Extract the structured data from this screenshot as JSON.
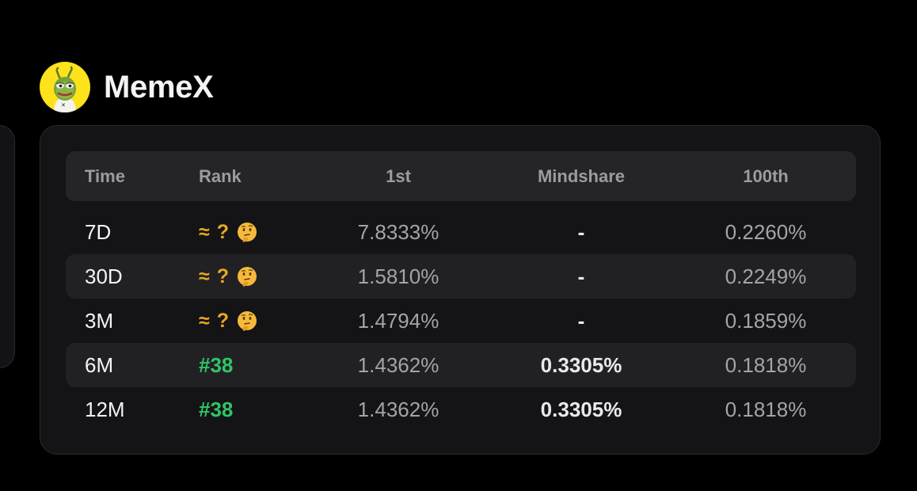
{
  "project": {
    "name": "MemeX",
    "avatar_icon": "pepe-frog-icon",
    "avatar_bg": "#fde21c"
  },
  "table": {
    "headers": {
      "time": "Time",
      "rank": "Rank",
      "first": "1st",
      "mindshare": "Mindshare",
      "hundredth": "100th"
    },
    "rows": [
      {
        "time": "7D",
        "rank": "",
        "rank_approx": "≈",
        "rank_unknown": "?",
        "rank_icon": "thinking-face-icon",
        "first": "7.8333%",
        "mindshare": "-",
        "hundredth": "0.2260%"
      },
      {
        "time": "30D",
        "rank": "",
        "rank_approx": "≈",
        "rank_unknown": "?",
        "rank_icon": "thinking-face-icon",
        "first": "1.5810%",
        "mindshare": "-",
        "hundredth": "0.2249%"
      },
      {
        "time": "3M",
        "rank": "",
        "rank_approx": "≈",
        "rank_unknown": "?",
        "rank_icon": "thinking-face-icon",
        "first": "1.4794%",
        "mindshare": "-",
        "hundredth": "0.1859%"
      },
      {
        "time": "6M",
        "rank": "#38",
        "first": "1.4362%",
        "mindshare": "0.3305%",
        "hundredth": "0.1818%"
      },
      {
        "time": "12M",
        "rank": "#38",
        "first": "1.4362%",
        "mindshare": "0.3305%",
        "hundredth": "0.1818%"
      }
    ]
  },
  "colors": {
    "rank_known": "#2fc566",
    "rank_unknown": "#e8a820"
  }
}
